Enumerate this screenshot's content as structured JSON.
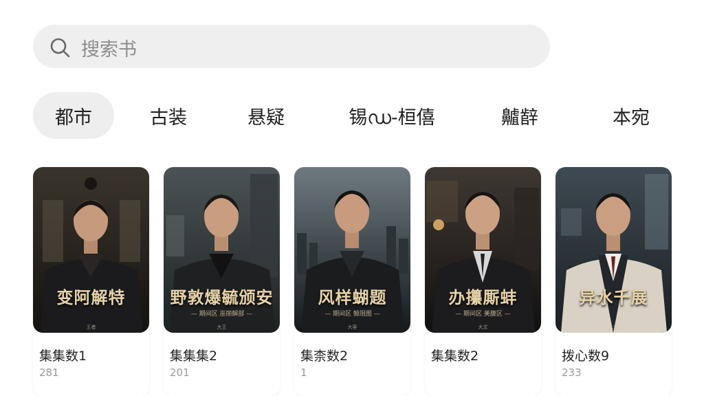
{
  "search": {
    "placeholder": "搜索书"
  },
  "tabs": [
    {
      "label": "都市",
      "active": true
    },
    {
      "label": "古装",
      "active": false
    },
    {
      "label": "悬疑",
      "active": false
    },
    {
      "label": "锡ഡ-桓僖",
      "active": false
    },
    {
      "label": "齇辪",
      "active": false
    },
    {
      "label": "本宛",
      "active": false
    }
  ],
  "cards": [
    {
      "poster_title": "变阿解特",
      "poster_sub": "",
      "poster_foot": "王者",
      "name": "集集数1",
      "count": "281"
    },
    {
      "poster_title": "野敦爆毓颁安",
      "poster_sub": "— 期间区 巫丽解部 —",
      "poster_foot": "大王",
      "name": "集集集2",
      "count": "201"
    },
    {
      "poster_title": "风样蝴题",
      "poster_sub": "— 期间区 鲸阻图 —",
      "poster_foot": "大客",
      "name": "集柰数2",
      "count": "1"
    },
    {
      "poster_title": "办攥厮蚌",
      "poster_sub": "— 期间区 美腹区 —",
      "poster_foot": "大文",
      "name": "集集数2",
      "count": ""
    },
    {
      "poster_title": "异水千展",
      "poster_sub": "",
      "poster_foot": "大学",
      "name": "拨心数9",
      "count": "233"
    }
  ],
  "colors": {
    "search_bg": "#efefef",
    "active_tab_bg": "#eeeeee",
    "poster_title": "#e7d3a8"
  }
}
